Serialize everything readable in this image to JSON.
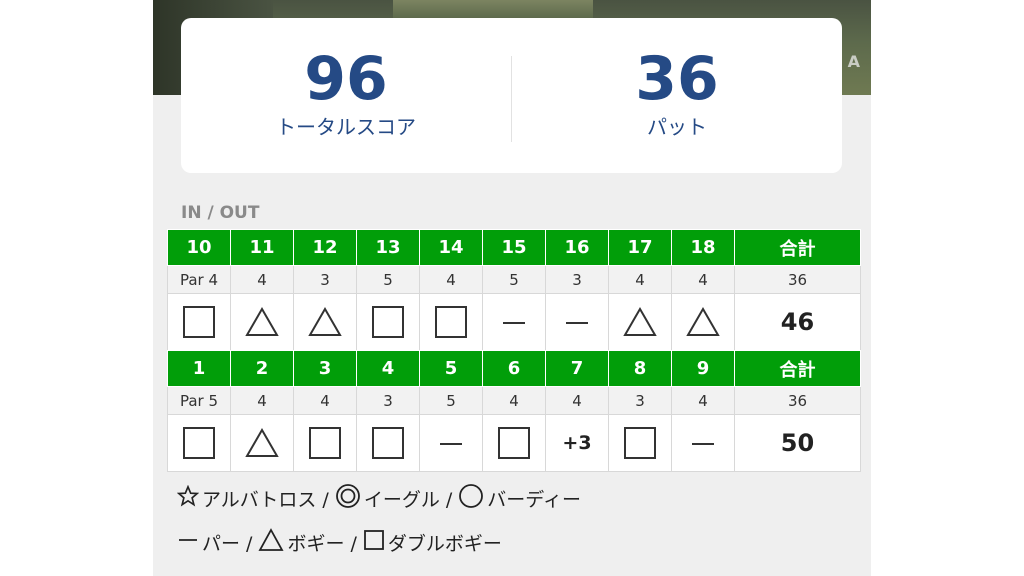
{
  "hero": {
    "partial_text": "A"
  },
  "summary": {
    "total_score": "96",
    "total_score_label": "トータルスコア",
    "putts": "36",
    "putts_label": "パット"
  },
  "section_title": "IN / OUT",
  "in_card": {
    "holes": [
      "10",
      "11",
      "12",
      "13",
      "14",
      "15",
      "16",
      "17",
      "18"
    ],
    "total_label": "合計",
    "pars": [
      "Par 4",
      "4",
      "3",
      "5",
      "4",
      "5",
      "3",
      "4",
      "4"
    ],
    "par_total": "36",
    "scores": [
      {
        "symbol": "square-icon"
      },
      {
        "symbol": "triangle-icon"
      },
      {
        "symbol": "triangle-icon"
      },
      {
        "symbol": "square-icon"
      },
      {
        "symbol": "square-icon"
      },
      {
        "symbol": "dash-icon"
      },
      {
        "symbol": "dash-icon"
      },
      {
        "symbol": "triangle-icon"
      },
      {
        "symbol": "triangle-icon"
      }
    ],
    "score_total": "46"
  },
  "out_card": {
    "holes": [
      "1",
      "2",
      "3",
      "4",
      "5",
      "6",
      "7",
      "8",
      "9"
    ],
    "total_label": "合計",
    "pars": [
      "Par 5",
      "4",
      "4",
      "3",
      "5",
      "4",
      "4",
      "3",
      "4"
    ],
    "par_total": "36",
    "scores": [
      {
        "symbol": "square-icon"
      },
      {
        "symbol": "triangle-icon"
      },
      {
        "symbol": "square-icon"
      },
      {
        "symbol": "square-icon"
      },
      {
        "symbol": "dash-icon"
      },
      {
        "symbol": "square-icon"
      },
      {
        "symbol": "text",
        "text": "+3"
      },
      {
        "symbol": "square-icon"
      },
      {
        "symbol": "dash-icon"
      }
    ],
    "score_total": "50"
  },
  "legend": {
    "albatross": "アルバトロス /",
    "eagle": "イーグル /",
    "birdie": "バーディー",
    "par": "パー /",
    "bogey": "ボギー /",
    "double_bogey": "ダブルボギー"
  },
  "colors": {
    "header_green": "#019e09",
    "score_blue": "#254a85",
    "page_bg": "#efefef"
  }
}
